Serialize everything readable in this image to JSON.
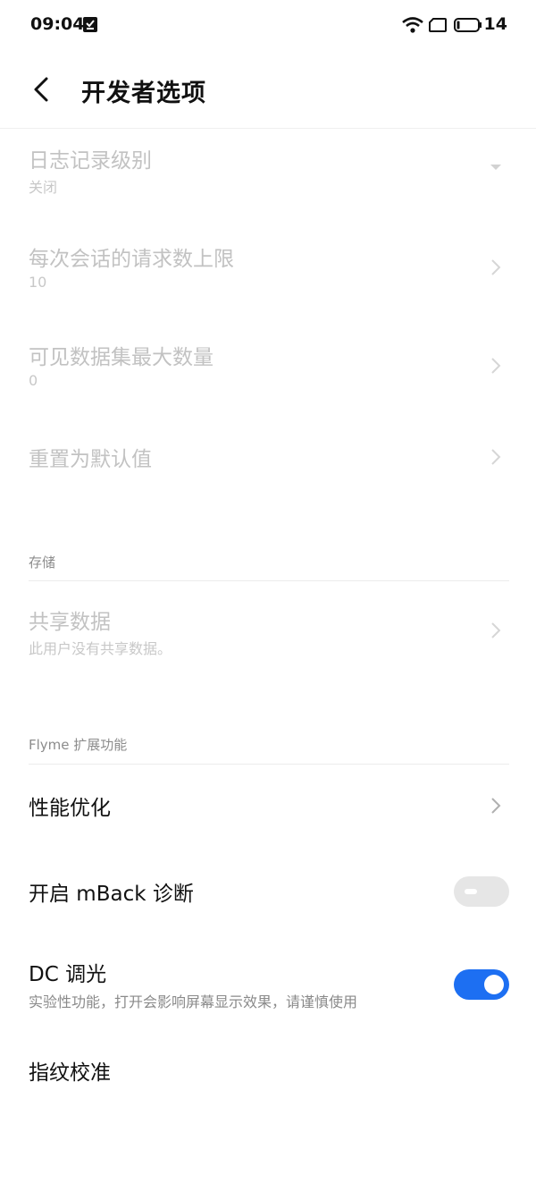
{
  "status_bar": {
    "time": "09:04",
    "battery_level": "14"
  },
  "header": {
    "title": "开发者选项"
  },
  "items": {
    "log_level": {
      "title": "日志记录级别",
      "value": "关闭"
    },
    "requests_per_session": {
      "title": "每次会话的请求数上限",
      "value": "10"
    },
    "visible_datasets": {
      "title": "可见数据集最大数量",
      "value": "0"
    },
    "reset_defaults": {
      "title": "重置为默认值"
    }
  },
  "storage": {
    "section_title": "存储",
    "shared_data": {
      "title": "共享数据",
      "value": "此用户没有共享数据。"
    }
  },
  "flyme": {
    "section_title": "Flyme 扩展功能",
    "performance": {
      "title": "性能优化"
    },
    "mback": {
      "title": "开启 mBack 诊断",
      "enabled": false
    },
    "dc_dimming": {
      "title": "DC 调光",
      "description": "实验性功能，打开会影响屏幕显示效果，请谨慎使用",
      "enabled": true
    },
    "fingerprint": {
      "title": "指纹校准"
    }
  },
  "colors": {
    "accent": "#1d6ff2",
    "disabled_text": "#c2c2c2",
    "secondary_text": "#8a8a8a"
  }
}
